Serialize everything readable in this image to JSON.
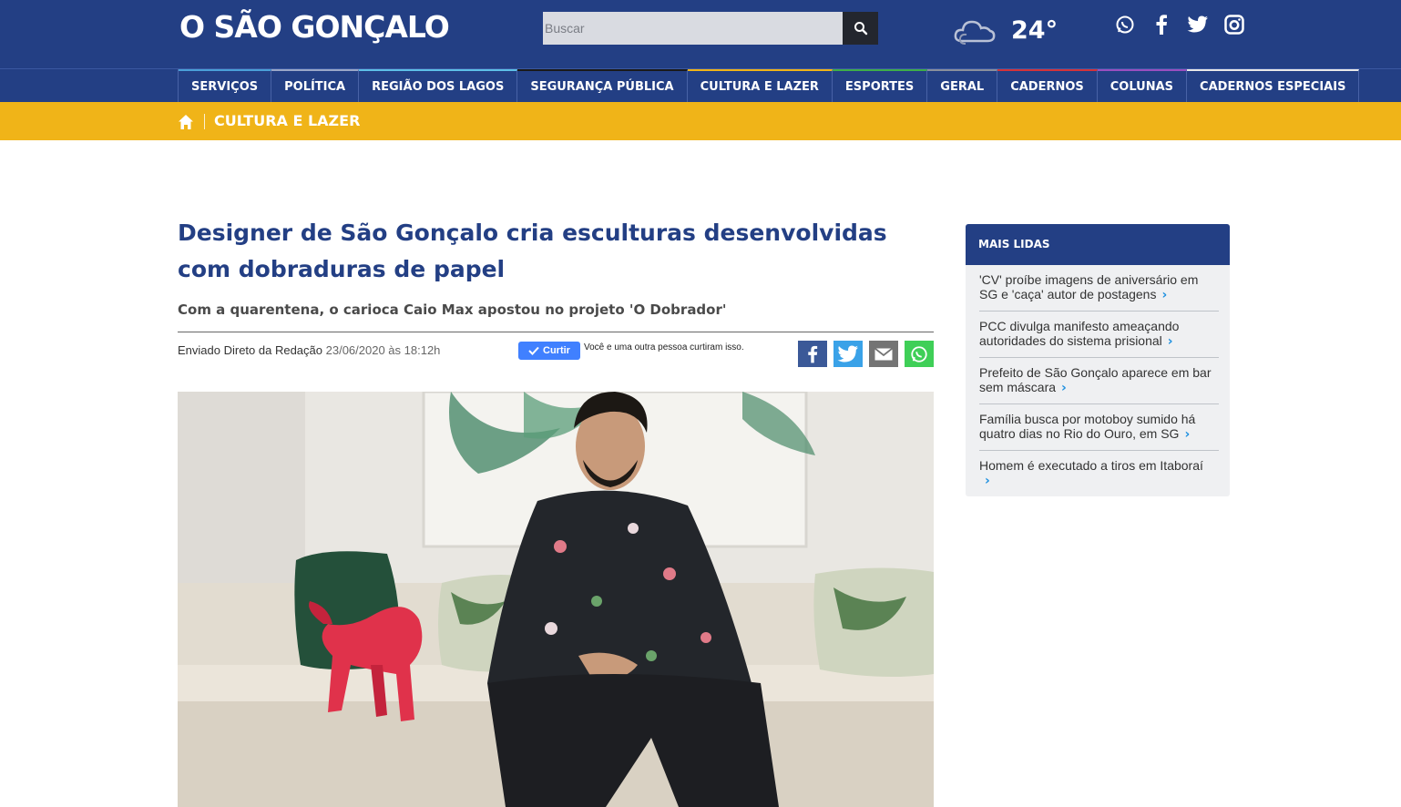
{
  "header": {
    "logo": "O SÃO GONÇALO",
    "search": {
      "placeholder": "Buscar"
    },
    "weather": {
      "temperature": "24°",
      "icon": "cloud-icon"
    },
    "social": [
      "whatsapp-icon",
      "facebook-icon",
      "twitter-icon",
      "instagram-icon"
    ]
  },
  "nav": {
    "items": [
      {
        "label": "SERVIÇOS",
        "accent": "#4aa0d8"
      },
      {
        "label": "POLÍTICA",
        "accent": "#9aa7c8"
      },
      {
        "label": "REGIÃO DOS LAGOS",
        "accent": "#5ec0e8"
      },
      {
        "label": "SEGURANÇA PÚBLICA",
        "accent": "#1a1a1a"
      },
      {
        "label": "CULTURA E LAZER",
        "accent": "#f0b418"
      },
      {
        "label": "ESPORTES",
        "accent": "#3fae49"
      },
      {
        "label": "GERAL",
        "accent": "#8a8f9c"
      },
      {
        "label": "CADERNOS",
        "accent": "#d5333a"
      },
      {
        "label": "COLUNAS",
        "accent": "#9a4fc0"
      },
      {
        "label": "CADERNOS ESPECIAIS",
        "accent": "#e8e8e8"
      }
    ]
  },
  "breadcrumb": {
    "label": "CULTURA E LAZER"
  },
  "article": {
    "title": "Designer de São Gonçalo cria esculturas desenvolvidas com dobraduras de papel",
    "subtitle": "Com a quarentena, o carioca Caio Max apostou no projeto 'O Dobrador'",
    "author": "Enviado Direto da Redação",
    "date": "23/06/2020 às 18:12h",
    "like_label": "Curtir",
    "like_text": "Você e uma outra pessoa curtiram isso."
  },
  "share": [
    "facebook-share-icon",
    "twitter-share-icon",
    "email-share-icon",
    "whatsapp-share-icon"
  ],
  "sidebar": {
    "title": "MAIS LIDAS",
    "items": [
      {
        "label": "'CV' proíbe imagens de aniversário em SG e 'caça' autor de postagens"
      },
      {
        "label": "PCC divulga manifesto ameaçando autoridades do sistema prisional"
      },
      {
        "label": "Prefeito de São Gonçalo aparece em bar sem máscara"
      },
      {
        "label": "Família busca por motoboy sumido há quatro dias no Rio do Ouro, em SG"
      },
      {
        "label": "Homem é executado a tiros em Itaboraí"
      }
    ]
  },
  "colors": {
    "brand": "#233f84",
    "section": "#f0b418",
    "accent": "#1e90e0"
  }
}
